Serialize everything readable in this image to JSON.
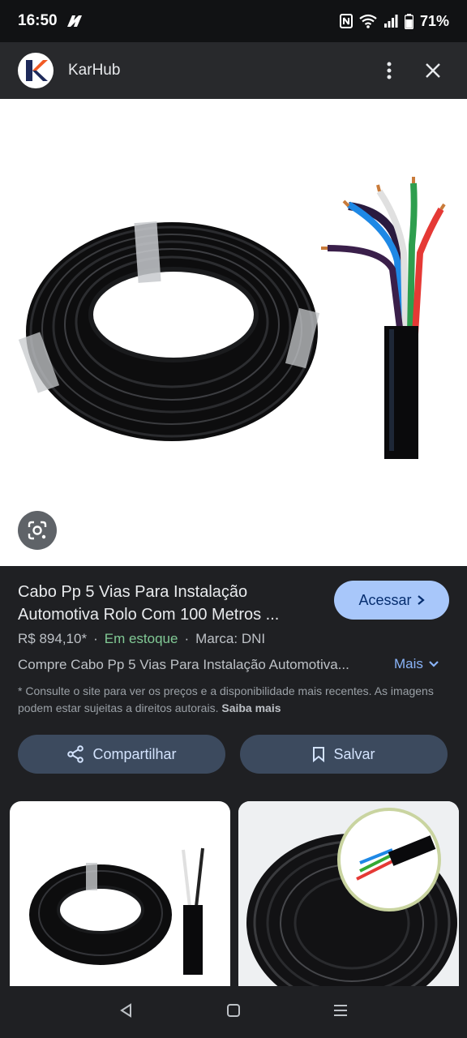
{
  "status": {
    "time": "16:50",
    "battery": "71%",
    "icons": [
      "nfc-icon",
      "wifi-icon",
      "signal-icon",
      "battery-icon"
    ]
  },
  "header": {
    "app_title": "KarHub",
    "logo_letter": "K",
    "icons": [
      "more-vert-icon",
      "close-icon"
    ]
  },
  "product": {
    "title": "Cabo Pp 5 Vias Para Instalação Automotiva Rolo Com 100 Metros ...",
    "price": "R$ 894,10*",
    "stock": "Em estoque",
    "brand": "Marca: DNI",
    "separator": "·",
    "description": "Compre Cabo Pp 5 Vias Para Instalação Automotiva...",
    "more_label": "Mais",
    "note": "* Consulte o site para ver os preços e a disponibilidade mais recentes. As imagens podem estar sujeitas a direitos autorais.",
    "learn_more": "Saiba mais",
    "visit_label": "Acessar"
  },
  "actions": {
    "share_label": "Compartilhar",
    "save_label": "Salvar"
  },
  "colors": {
    "accent": "#a8c7fa",
    "in_stock": "#81c995",
    "link": "#8ab4f8",
    "pill_bg": "#3c4a5e",
    "logo_orange": "#f15a24",
    "logo_navy": "#1e2a5a"
  }
}
